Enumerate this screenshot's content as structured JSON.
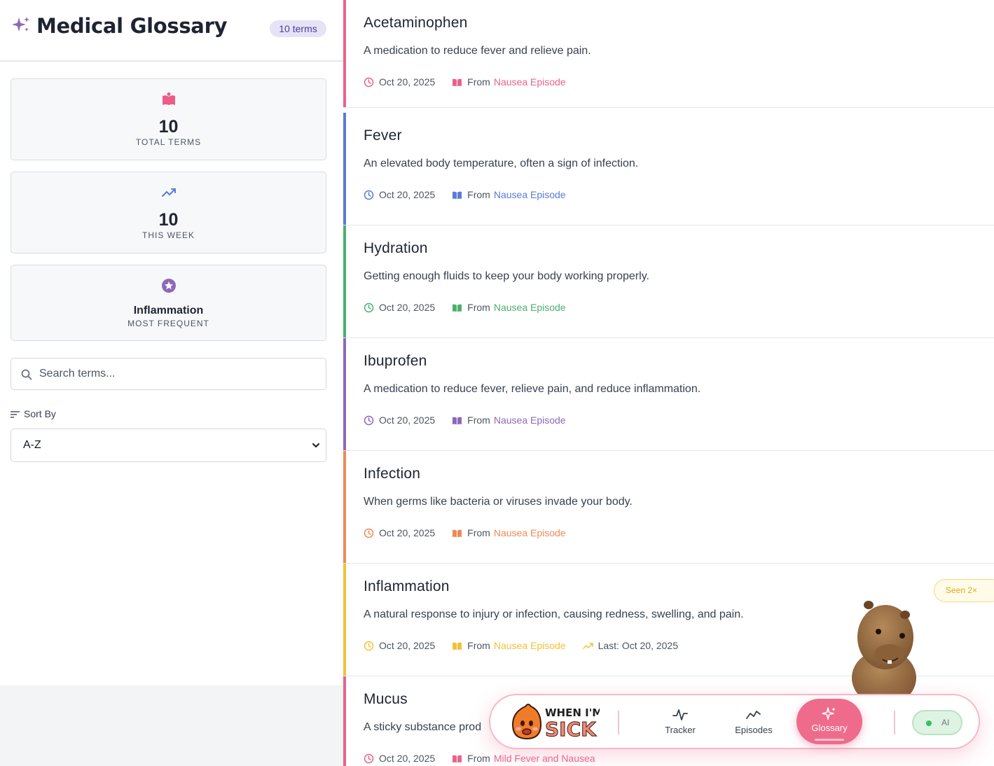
{
  "sidebar": {
    "title": "Medical Glossary",
    "count_badge": "10 terms",
    "stats": [
      {
        "value": "10",
        "label": "TOTAL TERMS",
        "icon": "book-open-icon"
      },
      {
        "value": "10",
        "label": "THIS WEEK",
        "icon": "trending-up-icon"
      },
      {
        "value": "Inflammation",
        "label": "MOST FREQUENT",
        "icon": "star-circle-icon"
      }
    ],
    "search": {
      "placeholder": "Search terms...",
      "value": ""
    },
    "sort": {
      "label": "Sort By",
      "selected": "A-Z"
    }
  },
  "terms": [
    {
      "title": "Acetaminophen",
      "definition": "A medication to reduce fever and relieve pain.",
      "date": "Oct 20, 2025",
      "from_label": "From",
      "source": "Nausea Episode",
      "color": "#e9638a"
    },
    {
      "title": "Fever",
      "definition": "An elevated body temperature, often a sign of infection.",
      "date": "Oct 20, 2025",
      "from_label": "From",
      "source": "Nausea Episode",
      "color": "#5a7bd6"
    },
    {
      "title": "Hydration",
      "definition": "Getting enough fluids to keep your body working properly.",
      "date": "Oct 20, 2025",
      "from_label": "From",
      "source": "Nausea Episode",
      "color": "#4caf6e"
    },
    {
      "title": "Ibuprofen",
      "definition": "A medication to reduce fever, relieve pain, and reduce inflammation.",
      "date": "Oct 20, 2025",
      "from_label": "From",
      "source": "Nausea Episode",
      "color": "#8e68b8"
    },
    {
      "title": "Infection",
      "definition": "When germs like bacteria or viruses invade your body.",
      "date": "Oct 20, 2025",
      "from_label": "From",
      "source": "Nausea Episode",
      "color": "#ee8a5a"
    },
    {
      "title": "Inflammation",
      "definition": "A natural response to injury or infection, causing redness, swelling, and pain.",
      "date": "Oct 20, 2025",
      "from_label": "From",
      "source": "Nausea Episode",
      "color": "#f0c23a",
      "last": "Last: Oct 20, 2025",
      "badge": "Seen 2×"
    },
    {
      "title": "Mucus",
      "definition": "A sticky substance prod",
      "date": "Oct 20, 2025",
      "from_label": "From",
      "source": "Mild Fever and Nausea",
      "color": "#e9638a"
    }
  ],
  "nav": {
    "logo_text_top": "WHEN I'M",
    "logo_text_bottom": "SICK",
    "items": [
      {
        "label": "Tracker",
        "icon": "activity-icon"
      },
      {
        "label": "Episodes",
        "icon": "trend-line-icon"
      },
      {
        "label": "Glossary",
        "icon": "sparkles-icon",
        "active": true
      }
    ],
    "ai_label": "AI"
  }
}
